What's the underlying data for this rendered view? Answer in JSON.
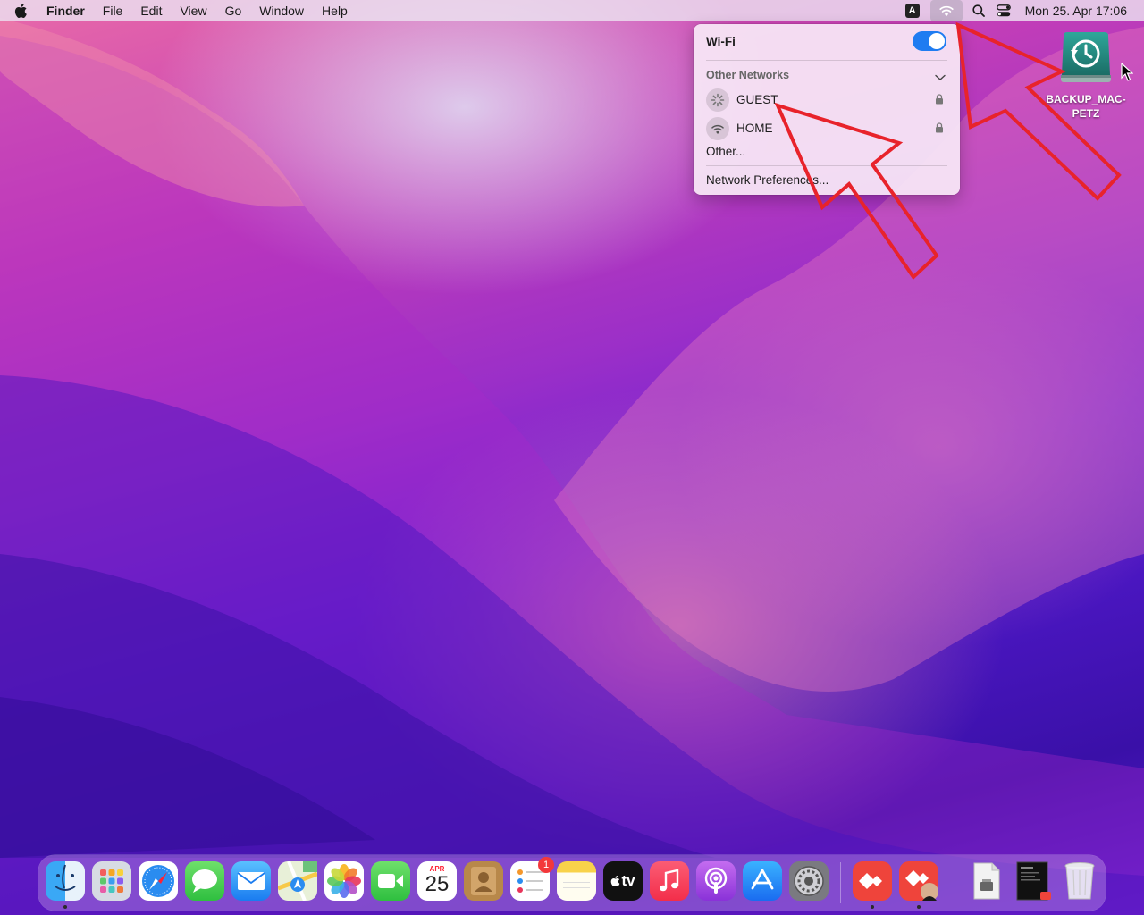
{
  "menubar": {
    "app_name": "Finder",
    "menus": [
      "File",
      "Edit",
      "View",
      "Go",
      "Window",
      "Help"
    ],
    "input_source": "A",
    "clock": "Mon 25. Apr  17:06"
  },
  "wifi_menu": {
    "title": "Wi-Fi",
    "enabled": true,
    "section_label": "Other Networks",
    "networks": [
      {
        "name": "GUEST",
        "status": "connecting",
        "locked": true
      },
      {
        "name": "HOME",
        "status": "available",
        "locked": true
      }
    ],
    "other_label": "Other...",
    "prefs_label": "Network Preferences..."
  },
  "desktop": {
    "disk_label_line1": "BACKUP_MAC-",
    "disk_label_line2": "PETZ"
  },
  "colors": {
    "accent": "#1f7cf1",
    "annotation_arrow": "#e8232b"
  },
  "dock": {
    "apps": [
      {
        "name": "Finder",
        "icon": "finder-icon",
        "running": true
      },
      {
        "name": "Launchpad",
        "icon": "launchpad-icon",
        "running": false
      },
      {
        "name": "Safari",
        "icon": "safari-icon",
        "running": false
      },
      {
        "name": "Messages",
        "icon": "messages-icon",
        "running": false
      },
      {
        "name": "Mail",
        "icon": "mail-icon",
        "running": false
      },
      {
        "name": "Maps",
        "icon": "maps-icon",
        "running": false
      },
      {
        "name": "Photos",
        "icon": "photos-icon",
        "running": false
      },
      {
        "name": "FaceTime",
        "icon": "facetime-icon",
        "running": false
      },
      {
        "name": "Calendar",
        "icon": "calendar-icon",
        "running": false
      },
      {
        "name": "Contacts",
        "icon": "contacts-icon",
        "running": false
      },
      {
        "name": "Reminders",
        "icon": "reminders-icon",
        "running": false
      },
      {
        "name": "Notes",
        "icon": "notes-icon",
        "running": false
      },
      {
        "name": "TV",
        "icon": "appletv-icon",
        "running": false
      },
      {
        "name": "Music",
        "icon": "music-icon",
        "running": false
      },
      {
        "name": "Podcasts",
        "icon": "podcasts-icon",
        "running": false
      },
      {
        "name": "App Store",
        "icon": "appstore-icon",
        "running": false
      },
      {
        "name": "System Preferences",
        "icon": "system-preferences-icon",
        "running": false
      },
      {
        "name": "AnyDesk",
        "icon": "anydesk-icon",
        "running": true
      },
      {
        "name": "AnyDesk Session",
        "icon": "anydesk-session-icon",
        "running": true
      }
    ],
    "calendar_month": "APR",
    "calendar_day": "25",
    "reminders_badge": "1",
    "tv_label": "tv",
    "extras": [
      {
        "name": "Document",
        "icon": "document-icon"
      },
      {
        "name": "Terminal Window",
        "icon": "terminal-icon"
      },
      {
        "name": "Trash",
        "icon": "trash-icon"
      }
    ]
  }
}
